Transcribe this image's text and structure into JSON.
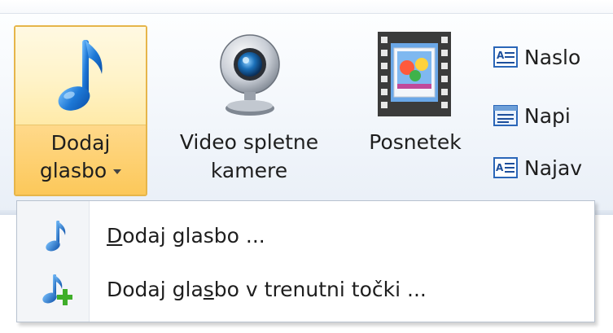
{
  "ribbon": {
    "add_music": {
      "line1": "Dodaj",
      "line2": "glasbo",
      "icon": "music-note-icon"
    },
    "webcam": {
      "line1": "Video spletne",
      "line2": "kamere",
      "icon": "webcam-icon"
    },
    "snapshot": {
      "line1": "Posnetek",
      "icon": "film-frame-icon"
    },
    "text_buttons": [
      {
        "label": "Naslo",
        "icon": "title-text-icon"
      },
      {
        "label": "Napi",
        "icon": "caption-text-icon"
      },
      {
        "label": "Najav",
        "icon": "credits-text-icon"
      }
    ]
  },
  "menu": {
    "items": [
      {
        "first": "D",
        "rest": "odaj glasbo ...",
        "icon": "music-note-icon"
      },
      {
        "pre": "Dodaj gla",
        "ul": "s",
        "post": "bo v trenutni točki ...",
        "icon": "add-music-icon"
      }
    ]
  },
  "colors": {
    "hover_border": "#e6b54a",
    "hover_fill": "#fcc85a",
    "note_blue": "#1d78d6",
    "add_green": "#3fae2a"
  }
}
